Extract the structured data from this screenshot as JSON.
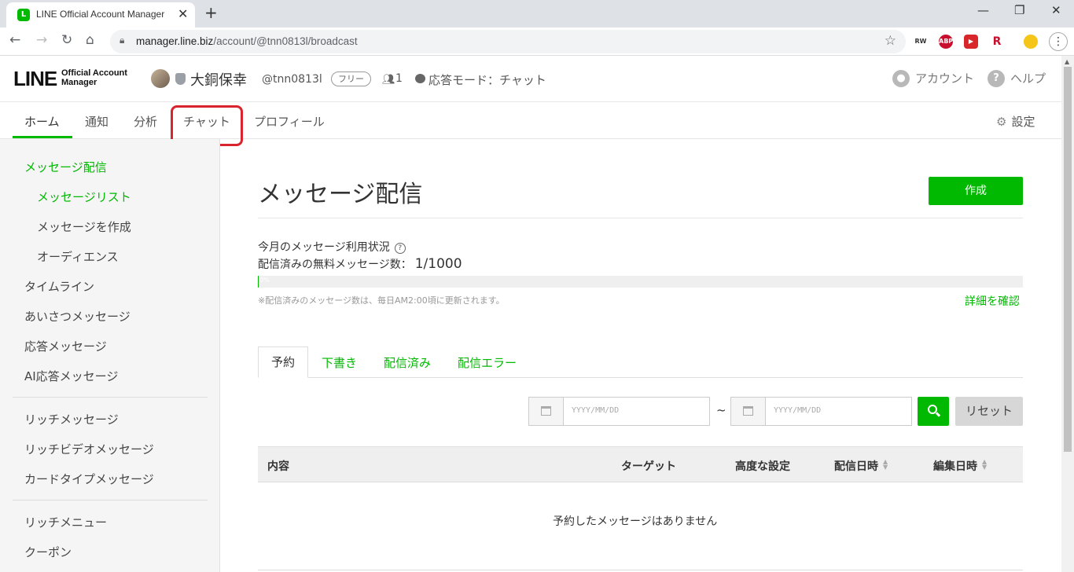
{
  "browser": {
    "tab_title": "LINE Official Account Manager",
    "tab_favicon": "L",
    "new_tab": "+",
    "url_host": "manager.line.biz",
    "url_path": "/account/@tnn0813l/broadcast",
    "extensions": [
      "RW",
      "ABP",
      "▶",
      "R"
    ]
  },
  "header": {
    "logo": "LINE",
    "logo_sub_1": "Official Account",
    "logo_sub_2": "Manager",
    "account_name": "大銅保幸",
    "account_id": "@tnn0813l",
    "plan": "フリー",
    "friends_count": "1",
    "response_mode": "応答モード：チャット",
    "account_link": "アカウント",
    "help_link": "ヘルプ"
  },
  "nav": {
    "tabs": [
      "ホーム",
      "通知",
      "分析",
      "チャット",
      "プロフィール"
    ],
    "active_tab": "ホーム",
    "highlighted_tab": "チャット",
    "settings": "設定"
  },
  "sidebar": {
    "section_title": "メッセージ配信",
    "sub_items": [
      "メッセージリスト",
      "メッセージを作成",
      "オーディエンス"
    ],
    "group1": [
      "タイムライン",
      "あいさつメッセージ",
      "応答メッセージ",
      "AI応答メッセージ"
    ],
    "group2": [
      "リッチメッセージ",
      "リッチビデオメッセージ",
      "カードタイプメッセージ"
    ],
    "group3": [
      "リッチメニュー",
      "クーポン"
    ]
  },
  "main": {
    "title": "メッセージ配信",
    "create_button": "作成",
    "usage_label": "今月のメッセージ利用状況",
    "usage_count_label": "配信済みの無料メッセージ数：",
    "usage_count": "1/1000",
    "usage_percent_text": "0%",
    "usage_fraction": 0.001,
    "note": "※配信済みのメッセージ数は、毎日AM2:00頃に更新されます。",
    "detail_link": "詳細を確認",
    "tabs": [
      "予約",
      "下書き",
      "配信済み",
      "配信エラー"
    ],
    "active_tab": "予約",
    "date_placeholder_from": "YYYY/MM/DD",
    "date_placeholder_to": "YYYY/MM/DD",
    "date_separator": "~",
    "reset_button": "リセット",
    "table_columns": [
      "内容",
      "ターゲット",
      "高度な設定",
      "配信日時",
      "編集日時"
    ],
    "empty_message": "予約したメッセージはありません"
  },
  "colors": {
    "brand_green": "#00b900",
    "highlight_red": "#d9232d"
  }
}
